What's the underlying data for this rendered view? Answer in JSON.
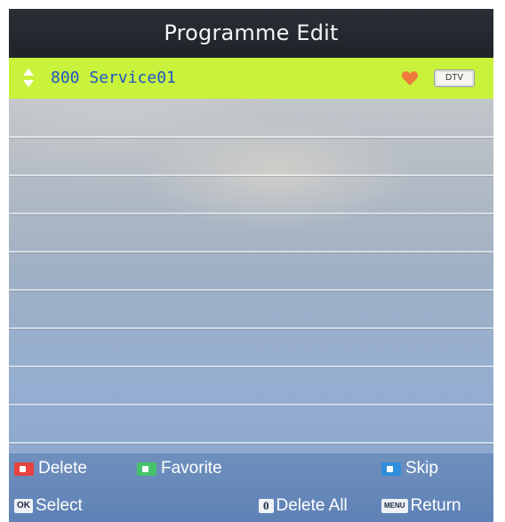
{
  "window": {
    "title": "Programme Edit"
  },
  "programme_list": {
    "rows": [
      {
        "number": "800",
        "name": "Service01",
        "favorite": true,
        "type": "DTV",
        "selected": true
      }
    ]
  },
  "help_bar": {
    "delete": {
      "label": "Delete",
      "key_color": "#e8423f"
    },
    "favorite": {
      "label": "Favorite",
      "key_color": "#46c26b"
    },
    "skip": {
      "label": "Skip",
      "key_color": "#2f8fdc"
    },
    "select": {
      "label": "Select",
      "key": "OK"
    },
    "delete_all": {
      "label": "Delete All",
      "key": "0"
    },
    "return": {
      "label": "Return",
      "key": "MENU"
    }
  },
  "colors": {
    "selected_row": "#c9f23c",
    "programme_text": "#1f55c8",
    "favorite_heart": "#ef7a3b",
    "title_bar": "#22272d",
    "help_bar": "#6585b8"
  },
  "icons": {
    "updown": "up-down-arrows-icon",
    "favorite": "heart-icon"
  }
}
